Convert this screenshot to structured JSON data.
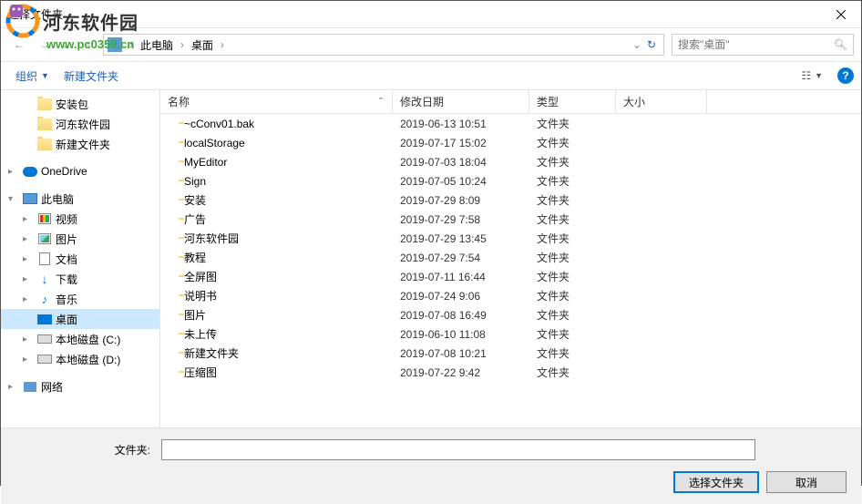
{
  "window": {
    "title": "选择文件夹"
  },
  "watermark": {
    "brand": "河东软件园",
    "url": "www.pc0359.cn"
  },
  "breadcrumb": {
    "items": [
      "此电脑",
      "桌面"
    ]
  },
  "search": {
    "placeholder": "搜索\"桌面\""
  },
  "toolbar": {
    "organize": "组织",
    "new_folder": "新建文件夹"
  },
  "sidebar": {
    "items": [
      {
        "label": "安装包",
        "type": "folder",
        "level": 1
      },
      {
        "label": "河东软件园",
        "type": "folder",
        "level": 1
      },
      {
        "label": "新建文件夹",
        "type": "folder",
        "level": 1
      },
      {
        "label": "OneDrive",
        "type": "onedrive",
        "level": 0,
        "expander": "▸"
      },
      {
        "label": "此电脑",
        "type": "pc",
        "level": 0,
        "expander": "▾"
      },
      {
        "label": "视频",
        "type": "video",
        "level": 1,
        "expander": "▸"
      },
      {
        "label": "图片",
        "type": "pic",
        "level": 1,
        "expander": "▸"
      },
      {
        "label": "文档",
        "type": "doc",
        "level": 1,
        "expander": "▸"
      },
      {
        "label": "下载",
        "type": "down",
        "level": 1,
        "expander": "▸"
      },
      {
        "label": "音乐",
        "type": "music",
        "level": 1,
        "expander": "▸"
      },
      {
        "label": "桌面",
        "type": "desk",
        "level": 1,
        "selected": true
      },
      {
        "label": "本地磁盘 (C:)",
        "type": "disk",
        "level": 1,
        "expander": "▸"
      },
      {
        "label": "本地磁盘 (D:)",
        "type": "disk",
        "level": 1,
        "expander": "▸"
      },
      {
        "label": "网络",
        "type": "net",
        "level": 0,
        "expander": "▸"
      }
    ]
  },
  "columns": {
    "name": "名称",
    "date": "修改日期",
    "type": "类型",
    "size": "大小"
  },
  "files": [
    {
      "name": "~cConv01.bak",
      "date": "2019-06-13 10:51",
      "type": "文件夹"
    },
    {
      "name": "localStorage",
      "date": "2019-07-17 15:02",
      "type": "文件夹"
    },
    {
      "name": "MyEditor",
      "date": "2019-07-03 18:04",
      "type": "文件夹"
    },
    {
      "name": "Sign",
      "date": "2019-07-05 10:24",
      "type": "文件夹"
    },
    {
      "name": "安装",
      "date": "2019-07-29 8:09",
      "type": "文件夹"
    },
    {
      "name": "广告",
      "date": "2019-07-29 7:58",
      "type": "文件夹"
    },
    {
      "name": "河东软件园",
      "date": "2019-07-29 13:45",
      "type": "文件夹"
    },
    {
      "name": "教程",
      "date": "2019-07-29 7:54",
      "type": "文件夹"
    },
    {
      "name": "全屏图",
      "date": "2019-07-11 16:44",
      "type": "文件夹"
    },
    {
      "name": "说明书",
      "date": "2019-07-24 9:06",
      "type": "文件夹"
    },
    {
      "name": "图片",
      "date": "2019-07-08 16:49",
      "type": "文件夹"
    },
    {
      "name": "未上传",
      "date": "2019-06-10 11:08",
      "type": "文件夹"
    },
    {
      "name": "新建文件夹",
      "date": "2019-07-08 10:21",
      "type": "文件夹"
    },
    {
      "name": "压缩图",
      "date": "2019-07-22 9:42",
      "type": "文件夹"
    }
  ],
  "bottom": {
    "folder_label": "文件夹:",
    "folder_value": "",
    "select_button": "选择文件夹",
    "cancel_button": "取消"
  }
}
